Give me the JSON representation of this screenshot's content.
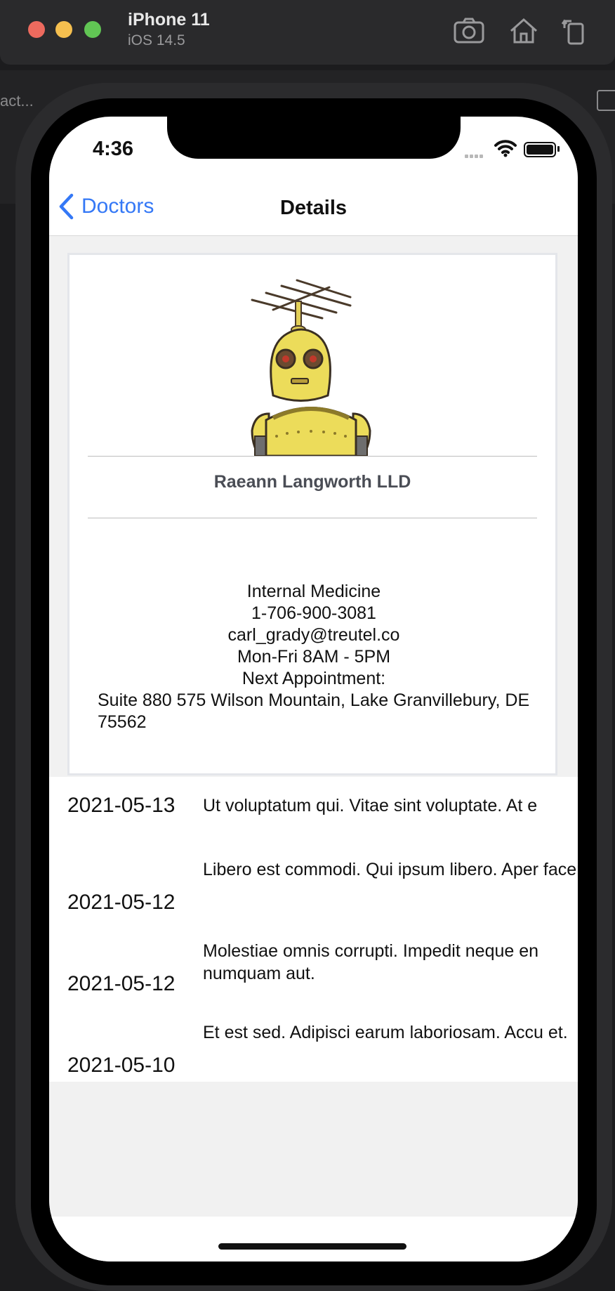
{
  "simulator": {
    "device_name": "iPhone 11",
    "os_version": "iOS 14.5",
    "tools": [
      "screenshot-icon",
      "home-icon",
      "rotate-icon"
    ]
  },
  "background": {
    "partial_label": "act..."
  },
  "status_bar": {
    "time": "4:36"
  },
  "navbar": {
    "back_label": "Doctors",
    "title": "Details"
  },
  "doctor": {
    "name": "Raeann Langworth LLD",
    "specialty": "Internal Medicine",
    "phone": "1-706-900-3081",
    "email": "carl_grady@treutel.co",
    "hours": "Mon-Fri 8AM - 5PM",
    "next_appointment_label": "Next Appointment:",
    "address": "Suite 880 575 Wilson Mountain, Lake Granvillebury, DE 75562"
  },
  "appointments": [
    {
      "date": "2021-05-13",
      "note": "Ut voluptatum qui. Vitae sint voluptate. At e"
    },
    {
      "date": "2021-05-12",
      "note": "Libero est commodi. Qui ipsum libero. Aper facere."
    },
    {
      "date": "2021-05-12",
      "note": "Molestiae omnis corrupti. Impedit neque en numquam aut."
    },
    {
      "date": "2021-05-10",
      "note": "Et est sed. Adipisci earum laboriosam. Accu et."
    }
  ],
  "colors": {
    "accent": "#3478f6",
    "window_chrome": "#2a2a2c",
    "content_background": "#f1f1f1"
  }
}
